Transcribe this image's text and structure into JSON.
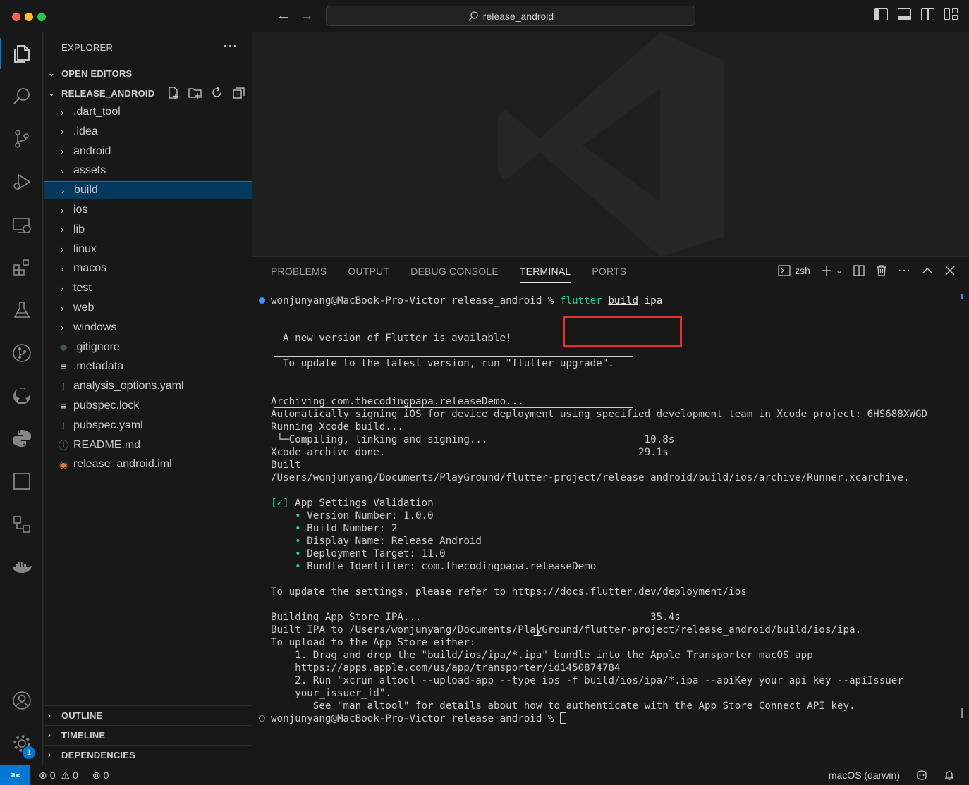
{
  "titlebar": {
    "search_text": "release_android"
  },
  "explorer": {
    "title": "EXPLORER",
    "more": "···",
    "open_editors": "OPEN EDITORS",
    "project": "RELEASE_ANDROID",
    "folders": [
      ".dart_tool",
      ".idea",
      "android",
      "assets",
      "build",
      "ios",
      "lib",
      "linux",
      "macos",
      "test",
      "web",
      "windows"
    ],
    "files": [
      {
        "name": ".gitignore",
        "icon": "◆",
        "color": "#41535b"
      },
      {
        "name": ".metadata",
        "icon": "≡",
        "color": "#cccccc"
      },
      {
        "name": "analysis_options.yaml",
        "icon": "!",
        "color": "#a074c4"
      },
      {
        "name": "pubspec.lock",
        "icon": "≡",
        "color": "#cccccc"
      },
      {
        "name": "pubspec.yaml",
        "icon": "!",
        "color": "#a074c4"
      },
      {
        "name": "README.md",
        "icon": "ⓘ",
        "color": "#519aba"
      },
      {
        "name": "release_android.iml",
        "icon": "◉",
        "color": "#e37933"
      }
    ],
    "outline": "OUTLINE",
    "timeline": "TIMELINE",
    "dependencies": "DEPENDENCIES"
  },
  "panel": {
    "tabs": [
      "PROBLEMS",
      "OUTPUT",
      "DEBUG CONSOLE",
      "TERMINAL",
      "PORTS"
    ],
    "active_tab": "TERMINAL",
    "shell": "zsh"
  },
  "terminal": {
    "prompt": "wonjunyang@MacBook-Pro-Victor release_android % ",
    "cmd_flutter": "flutter",
    "cmd_build": "build",
    "cmd_ipa": "ipa",
    "notice_line1": "A new version of Flutter is available!",
    "notice_line2": "To update to the latest version, run \"flutter upgrade\".",
    "l_archiving": "Archiving com.thecodingpapa.releaseDemo...",
    "l_signing": "Automatically signing iOS for device deployment using specified development team in Xcode project: 6HS688XWGD",
    "l_running": "Running Xcode build...",
    "l_compiling": " └─Compiling, linking and signing...                          10.8s",
    "l_archive_done": "Xcode archive done.                                          29.1s",
    "l_built": "Built",
    "l_built_path": "/Users/wonjunyang/Documents/PlayGround/flutter-project/release_android/build/ios/archive/Runner.xcarchive.",
    "check_mark": "[✓]",
    "l_validation": " App Settings Validation",
    "settings": [
      "Version Number: 1.0.0",
      "Build Number: 2",
      "Display Name: Release Android",
      "Deployment Target: 11.0",
      "Bundle Identifier: com.thecodingpapa.releaseDemo"
    ],
    "l_update_settings": "To update the settings, please refer to https://docs.flutter.dev/deployment/ios",
    "l_building_ipa": "Building App Store IPA...                                      35.4s",
    "l_built_ipa": "Built IPA to /Users/wonjunyang/Documents/PlayGround/flutter-project/release_android/build/ios/ipa.",
    "l_upload": "To upload to the App Store either:",
    "l_step1": "    1. Drag and drop the \"build/ios/ipa/*.ipa\" bundle into the Apple Transporter macOS app",
    "l_step1_url": "    https://apps.apple.com/us/app/transporter/id1450874784",
    "l_step2": "    2. Run \"xcrun altool --upload-app --type ios -f build/ios/ipa/*.ipa --apiKey your_api_key --apiIssuer",
    "l_step2_cont": "    your_issuer_id\".",
    "l_see": "       See \"man altool\" for details about how to authenticate with the App Store Connect API key."
  },
  "statusbar": {
    "errors": "0",
    "warnings": "0",
    "ports": "0",
    "os": "macOS (darwin)"
  },
  "activity": {
    "settings_badge": "1"
  },
  "colors": {
    "accent": "#0078d4",
    "highlight_box": "#e5312d",
    "terminal_green": "#23d18b"
  }
}
